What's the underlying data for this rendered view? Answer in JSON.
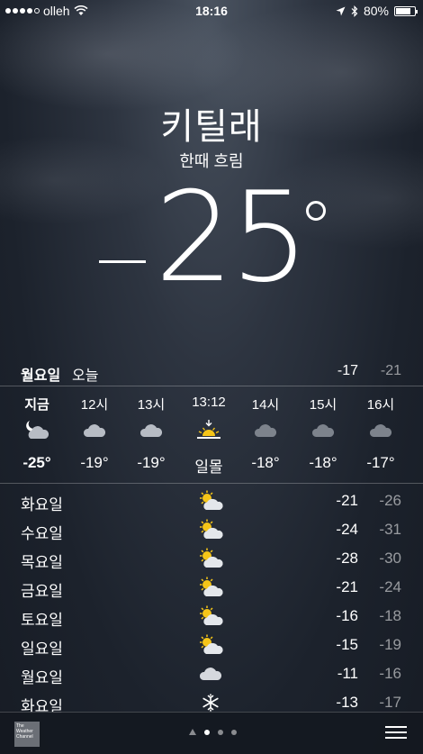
{
  "status_bar": {
    "carrier": "olleh",
    "time": "18:16",
    "battery": "80%",
    "battery_level": 0.8,
    "signal_icon": "signal-dots-icon",
    "wifi_icon": "wifi-icon",
    "location_icon": "location-arrow-icon",
    "bluetooth_icon": "bluetooth-icon"
  },
  "weather": {
    "city": "키틸래",
    "condition": "한때 흐림",
    "current_temp": "25"
  },
  "today": {
    "day": "월요일",
    "label": "오늘",
    "high": "-17",
    "low": "-21"
  },
  "hourly": [
    {
      "time": "지금",
      "icon": "cloud-moon-icon",
      "temp": "-25°"
    },
    {
      "time": "12시",
      "icon": "cloud-icon",
      "temp": "-19°"
    },
    {
      "time": "13시",
      "icon": "cloud-icon",
      "temp": "-19°"
    },
    {
      "time": "13:12",
      "icon": "sunset-icon",
      "temp": "일몰"
    },
    {
      "time": "14시",
      "icon": "cloud-icon",
      "temp": "-18°"
    },
    {
      "time": "15시",
      "icon": "cloud-icon",
      "temp": "-18°"
    },
    {
      "time": "16시",
      "icon": "cloud-icon",
      "temp": "-17°"
    }
  ],
  "daily": [
    {
      "day": "화요일",
      "icon": "partly-sunny-icon",
      "high": "-21",
      "low": "-26"
    },
    {
      "day": "수요일",
      "icon": "partly-sunny-icon",
      "high": "-24",
      "low": "-31"
    },
    {
      "day": "목요일",
      "icon": "partly-sunny-icon",
      "high": "-28",
      "low": "-30"
    },
    {
      "day": "금요일",
      "icon": "partly-sunny-icon",
      "high": "-21",
      "low": "-24"
    },
    {
      "day": "토요일",
      "icon": "partly-sunny-icon",
      "high": "-16",
      "low": "-18"
    },
    {
      "day": "일요일",
      "icon": "partly-sunny-icon",
      "high": "-15",
      "low": "-19"
    },
    {
      "day": "월요일",
      "icon": "cloud-icon",
      "high": "-11",
      "low": "-16"
    },
    {
      "day": "화요일",
      "icon": "snowflake-icon",
      "high": "-13",
      "low": "-17"
    }
  ],
  "bottom_bar": {
    "logo_text": "The Weather Channel",
    "page_count": 4,
    "active_page": 2,
    "list_icon": "list-icon"
  },
  "colors": {
    "background": "#1c222c",
    "text": "#ffffff",
    "muted_text": "#8f949c",
    "sun": "#f5c518"
  }
}
